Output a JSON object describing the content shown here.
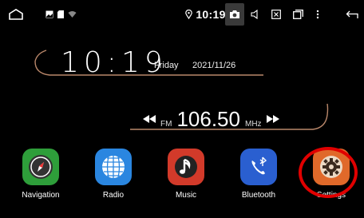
{
  "status_bar": {
    "time": "10:19",
    "icons": [
      "home-icon",
      "image-notification-icon",
      "sd-card-icon",
      "wifi-icon",
      "location-icon",
      "camera-icon",
      "volume-icon",
      "close-box-icon",
      "windows-icon",
      "menu-icon",
      "back-icon"
    ]
  },
  "clock": {
    "time": "10:19",
    "day": "Friday",
    "date": "2021/11/26"
  },
  "radio": {
    "band": "FM",
    "frequency": "106.50",
    "unit": "MHz"
  },
  "apps": [
    {
      "label": "Navigation",
      "icon": "compass-icon",
      "color": "#2e9e3a"
    },
    {
      "label": "Radio",
      "icon": "globe-icon",
      "color": "#2a86e0"
    },
    {
      "label": "Music",
      "icon": "music-note-icon",
      "color": "#d23a2a"
    },
    {
      "label": "Bluetooth",
      "icon": "bluetooth-phone-icon",
      "color": "#2a5fd0"
    },
    {
      "label": "Settings",
      "icon": "gear-icon",
      "color": "#e0692a"
    }
  ],
  "colors": {
    "arc": "#b9876a",
    "highlight": "#e00000"
  }
}
